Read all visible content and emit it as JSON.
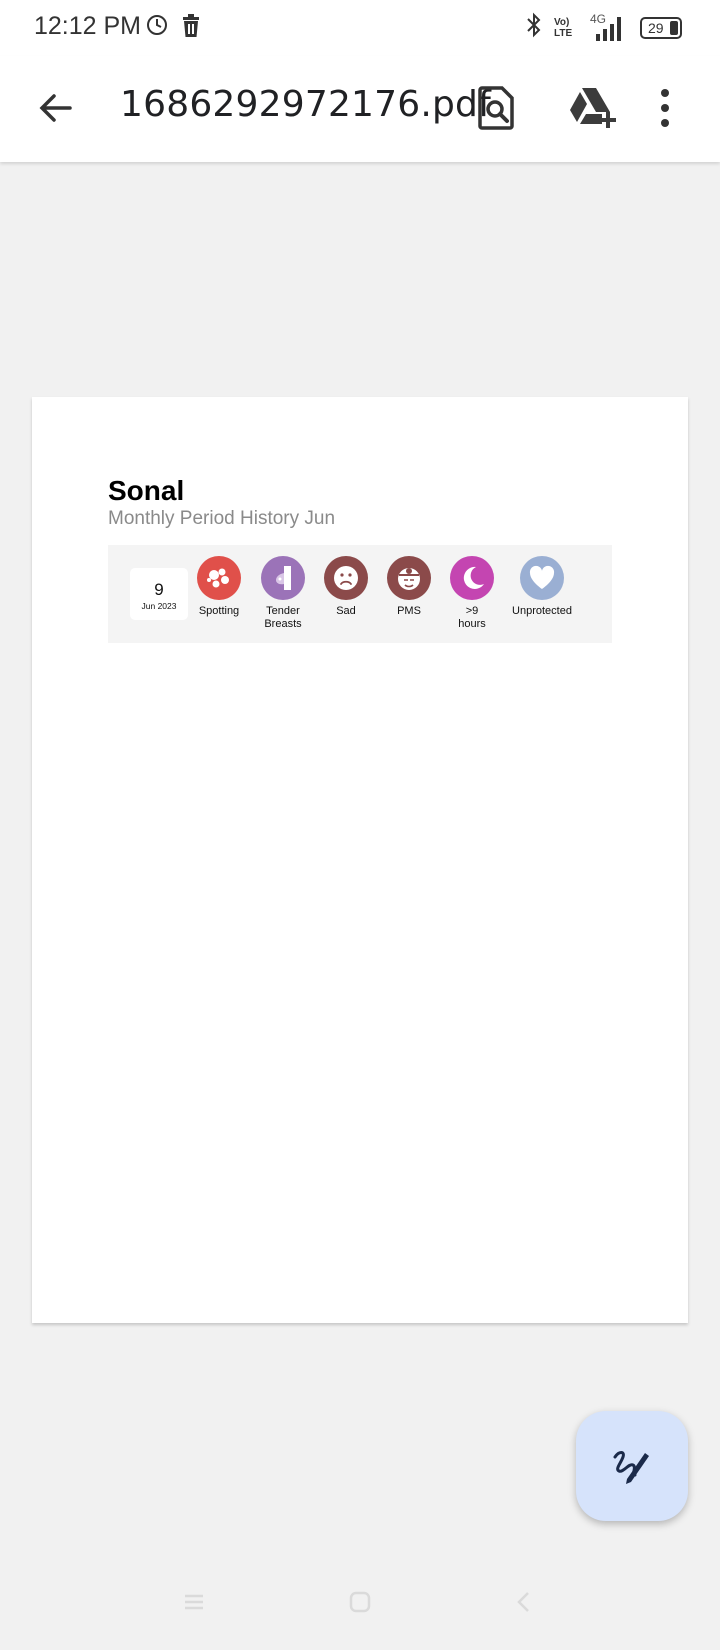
{
  "status_bar": {
    "time": "12:12 PM",
    "battery": "29",
    "network": "4G",
    "volte": "Vo) LTE"
  },
  "app_bar": {
    "title": "1686292972176.pdf"
  },
  "document": {
    "name": "Sonal",
    "subtitle": "Monthly Period History Jun",
    "entry": {
      "day": "9",
      "month": "Jun 2023",
      "symptoms": [
        {
          "label": "Spotting",
          "color": "#e0504a",
          "icon": "spotting-icon"
        },
        {
          "label": "Tender Breasts",
          "color": "#9b73b8",
          "icon": "breast-icon"
        },
        {
          "label": "Sad",
          "color": "#8b4a4a",
          "icon": "sad-face-icon"
        },
        {
          "label": "PMS",
          "color": "#8b4a4a",
          "icon": "pms-icon"
        },
        {
          "label": ">9 hours",
          "color": "#c445b1",
          "icon": "moon-sleep-icon"
        },
        {
          "label": "Unprotected",
          "color": "#9aafd3",
          "icon": "heart-icon"
        }
      ]
    }
  },
  "colors": {
    "fab_background": "#d6e3fb",
    "fab_icon": "#1b2a4a"
  }
}
